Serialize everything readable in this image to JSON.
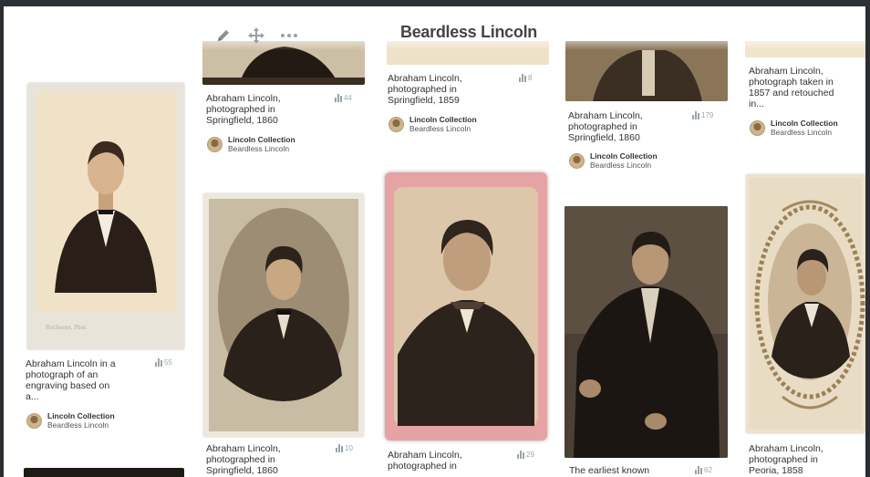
{
  "board": {
    "title": "Beardless Lincoln"
  },
  "toolbar": {
    "edit": "pencil-icon",
    "move": "move-icon",
    "more": "more-icon"
  },
  "pins": [
    {
      "id": "p1",
      "desc": "Abraham Lincoln in a photograph of an engraving based on a...",
      "stat": "55",
      "source": "Lincoln Collection",
      "board": "Beardless Lincoln"
    },
    {
      "id": "p2",
      "desc": "Abraham Lincoln, photographed in Springfield, 1860",
      "stat": "44",
      "source": "Lincoln Collection",
      "board": "Beardless Lincoln"
    },
    {
      "id": "p3",
      "desc": "Abraham Lincoln, photographed in Springfield, 1860",
      "stat": "10",
      "source": "",
      "board": ""
    },
    {
      "id": "p4",
      "desc": "Abraham Lincoln, photographed in Springfield, 1859",
      "stat": "8",
      "source": "Lincoln Collection",
      "board": "Beardless Lincoln"
    },
    {
      "id": "p5",
      "desc": "Abraham Lincoln, photographed in",
      "stat": "29",
      "source": "",
      "board": ""
    },
    {
      "id": "p6",
      "desc": "Abraham Lincoln, photographed in Springfield, 1860",
      "stat": "179",
      "source": "Lincoln Collection",
      "board": "Beardless Lincoln"
    },
    {
      "id": "p7",
      "desc": "The earliest known",
      "stat": "62",
      "source": "",
      "board": ""
    },
    {
      "id": "p8",
      "desc": "Abraham Lincoln, photograph taken in 1857 and retouched in...",
      "stat": "",
      "source": "Lincoln Collection",
      "board": "Beardless Lincoln"
    },
    {
      "id": "p9",
      "desc": "Abraham Lincoln, photographed in Peoria, 1858",
      "stat": "",
      "source": "",
      "board": ""
    }
  ]
}
